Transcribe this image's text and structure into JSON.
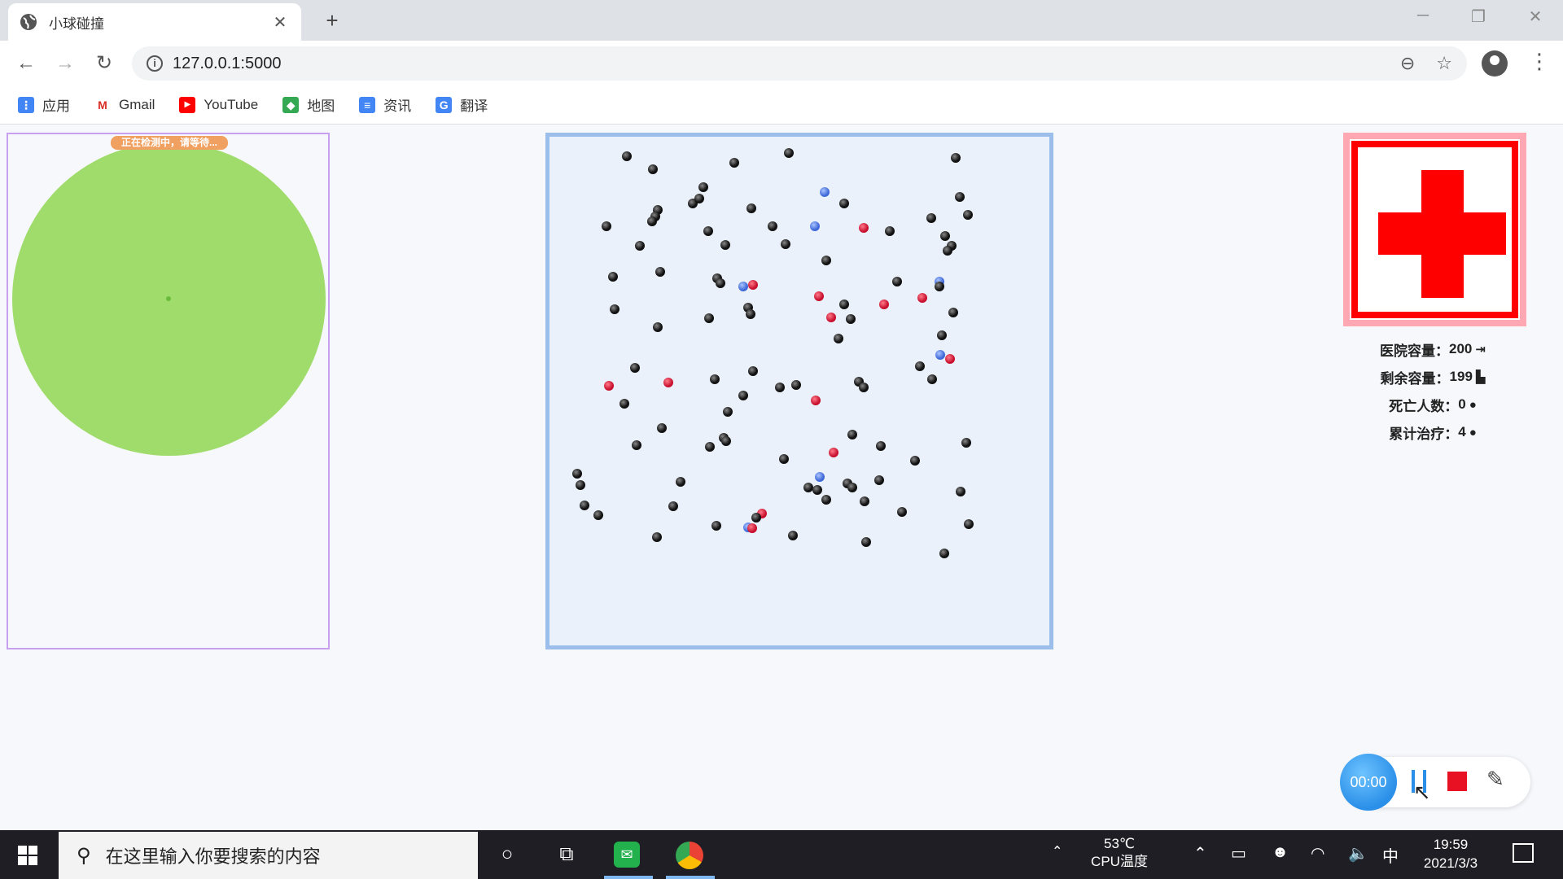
{
  "browser": {
    "tab_title": "小球碰撞",
    "url": "127.0.0.1:5000",
    "bookmarks": [
      {
        "label": "应用",
        "icon": "apps-grid-icon",
        "color": "#4285f4"
      },
      {
        "label": "Gmail",
        "icon": "gmail-icon",
        "color": "#d93025"
      },
      {
        "label": "YouTube",
        "icon": "youtube-icon",
        "color": "#ff0000"
      },
      {
        "label": "地图",
        "icon": "maps-icon",
        "color": "#34a853"
      },
      {
        "label": "资讯",
        "icon": "news-icon",
        "color": "#4285f4"
      },
      {
        "label": "翻译",
        "icon": "translate-icon",
        "color": "#4285f4"
      }
    ]
  },
  "left_panel": {
    "zone_label": "正在检测中，请等待...",
    "zone_color": "#9fdc6c"
  },
  "arena": {
    "ball_colors": {
      "black": "#111111",
      "red": "#c8102e",
      "blue": "#3f68d8"
    }
  },
  "hospital": {
    "stats": [
      {
        "label": "医院容量：",
        "value": "200",
        "icon": "sign-in-icon"
      },
      {
        "label": "剩余容量：",
        "value": "199",
        "icon": "bed-icon"
      },
      {
        "label": "死亡人数：",
        "value": "0",
        "icon": "person-icon"
      },
      {
        "label": "累计治疗：",
        "value": "4",
        "icon": "person-icon"
      }
    ]
  },
  "recorder": {
    "timer": "00:00"
  },
  "taskbar": {
    "search_placeholder": "在这里输入你要搜索的内容",
    "cpu_temp": "53℃",
    "cpu_label": "CPU温度",
    "ime": "中",
    "time": "19:59",
    "date": "2021/3/3"
  }
}
